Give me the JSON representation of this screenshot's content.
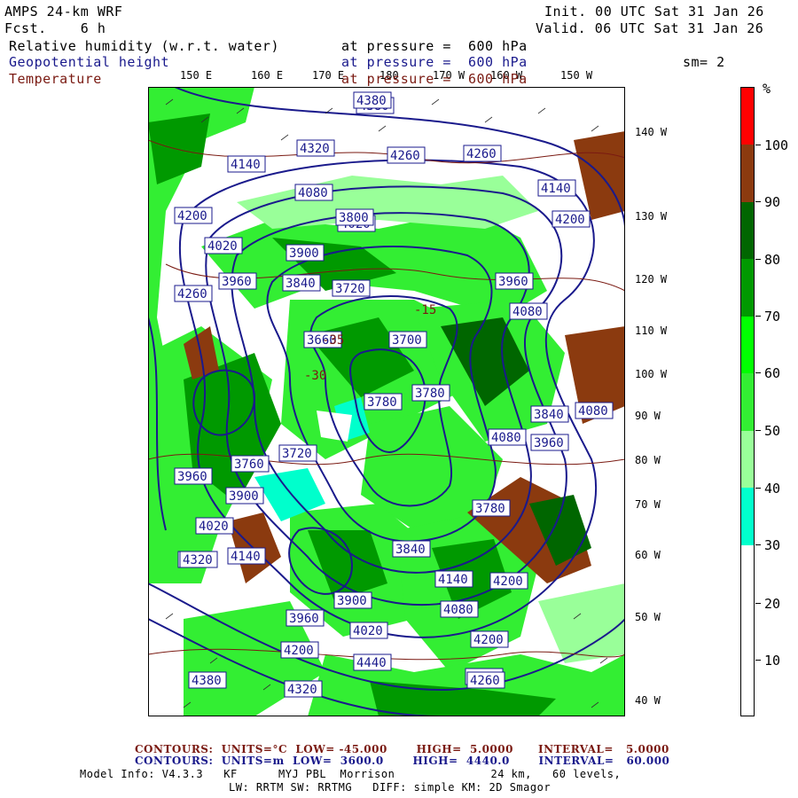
{
  "header": {
    "model": "AMPS 24-km WRF",
    "forecast": "Fcst.    6 h",
    "init": "Init. 00 UTC Sat 31 Jan 26",
    "valid": "Valid. 06 UTC Sat 31 Jan 26",
    "field1_name": "Relative humidity (w.r.t. water)",
    "field1_level": "at pressure =  600 hPa",
    "field2_name": "Geopotential height",
    "field2_level": "at pressure =  600 hPa",
    "field3_name": "Temperature",
    "field3_level": "at pressure =  600 hPa",
    "smoothing": "sm= 2"
  },
  "map": {
    "lon_labels": [
      "150 E",
      "160 E",
      "170 E",
      "180",
      "170 W",
      "160 W",
      "150 W"
    ],
    "lat_labels": [
      "140 W",
      "130 W",
      "120 W",
      "110 W",
      "100 W",
      "90 W",
      "80 W",
      "70 W",
      "60 W",
      "50 W",
      "40 W"
    ],
    "height_contour_labels": [
      "4380",
      "4320",
      "4260",
      "4260",
      "4200",
      "4200",
      "4140",
      "4080",
      "4080",
      "4020",
      "4020",
      "3960",
      "3960",
      "3900",
      "3840",
      "3840",
      "3800",
      "3780",
      "3780",
      "3720",
      "3720",
      "3660",
      "3700",
      "3760",
      "3900",
      "3960",
      "4020",
      "4080",
      "4140",
      "4200",
      "4260",
      "4320",
      "4380",
      "4440",
      "4320",
      "4260",
      "4200",
      "4080",
      "4020",
      "3960",
      "3900",
      "3840",
      "3780",
      "4140",
      "4200",
      "4260",
      "4320",
      "4380",
      "4140",
      "4080",
      "3960"
    ],
    "temperature_labels": [
      "-15",
      "-30",
      "-35"
    ]
  },
  "legend": {
    "unit": "%",
    "levels": [
      "10",
      "20",
      "30",
      "40",
      "50",
      "60",
      "70",
      "80",
      "90",
      "100"
    ],
    "colors": [
      "#ffffff",
      "#ffffff",
      "#ffffff",
      "#00ffcc",
      "#99ff99",
      "#33ee33",
      "#00ff00",
      "#009900",
      "#006600",
      "#8b3a0f",
      "#ff0000"
    ]
  },
  "footer": {
    "temp_contours": "CONTOURS:  UNITS=°C  LOW= -45.000       HIGH=  5.0000      INTERVAL=   5.0000",
    "height_contours": "CONTOURS:  UNITS=m  LOW=  3600.0       HIGH=  4440.0       INTERVAL=   60.000",
    "model_info_1": "Model Info: V4.3.3   KF      MYJ PBL  Morrison              24 km,   60 levels,",
    "model_info_2": "LW: RRTM SW: RRTMG   DIFF: simple KM: 2D Smagor"
  }
}
